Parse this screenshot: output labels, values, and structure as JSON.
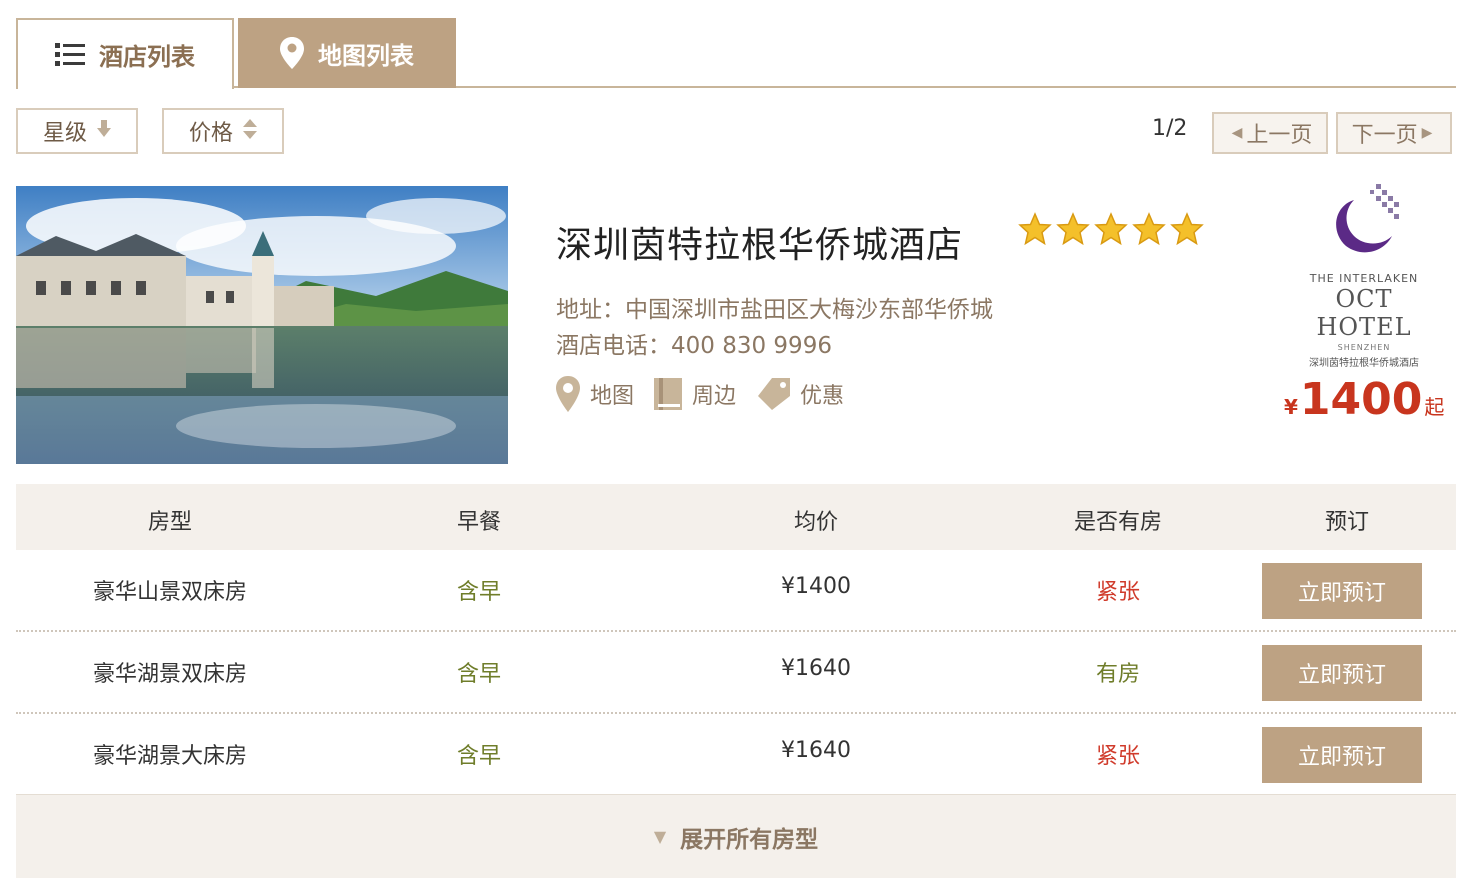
{
  "tabs": {
    "hotel_list": "酒店列表",
    "map_list": "地图列表"
  },
  "sort": {
    "star_label": "星级",
    "price_label": "价格"
  },
  "pager": {
    "page": "1/2",
    "prev": "上一页",
    "next": "下一页"
  },
  "hotel": {
    "name": "深圳茵特拉根华侨城酒店",
    "star_rating": 5,
    "address": "地址：中国深圳市盐田区大梅沙东部华侨城",
    "phone": "酒店电话：400 830 9996",
    "links": {
      "map": "地图",
      "nearby": "周边",
      "deals": "优惠"
    },
    "logo": {
      "line1": "THE INTERLAKEN",
      "line2": "OCT HOTEL",
      "line3": "SHENZHEN",
      "line4": "深圳茵特拉根华侨城酒店"
    },
    "price": {
      "currency": "¥",
      "value": "1400",
      "suffix": "起"
    }
  },
  "table": {
    "headers": {
      "room_type": "房型",
      "breakfast": "早餐",
      "avg_price": "均价",
      "availability": "是否有房",
      "booking": "预订"
    },
    "rows": [
      {
        "room_type": "豪华山景双床房",
        "breakfast": "含早",
        "price": "¥1400",
        "availability": "紧张",
        "book": "立即预订"
      },
      {
        "room_type": "豪华湖景双床房",
        "breakfast": "含早",
        "price": "¥1640",
        "availability": "有房",
        "book": "立即预订"
      },
      {
        "room_type": "豪华湖景大床房",
        "breakfast": "含早",
        "price": "¥1640",
        "availability": "紧张",
        "book": "立即预订"
      }
    ]
  },
  "expand_label": "展开所有房型",
  "colors": {
    "accent": "#bda283",
    "accent_text": "#8b7763",
    "price_red": "#c8351e",
    "breakfast_green": "#6f7d2a",
    "tight_red": "#d03b2b"
  }
}
